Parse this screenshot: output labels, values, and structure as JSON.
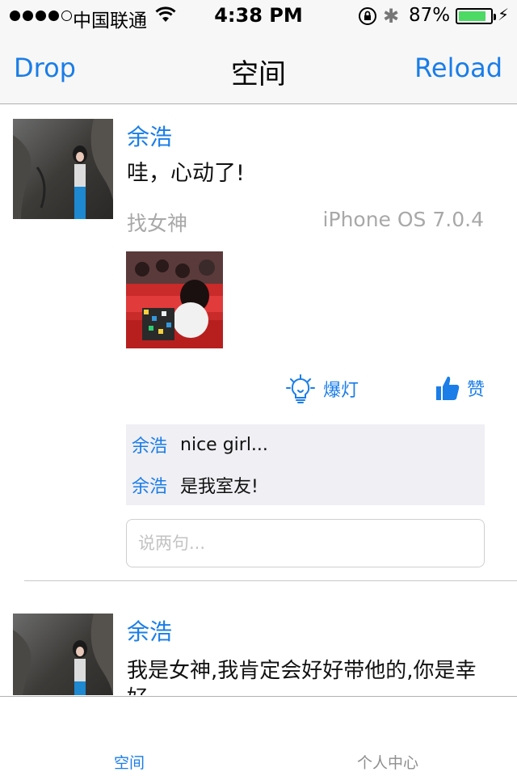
{
  "status_bar": {
    "carrier": "中国联通",
    "time": "4:38 PM",
    "battery_percent": "87%",
    "battery_level": 0.87,
    "signal_bars_filled": 4,
    "signal_bars_total": 5,
    "battery_color": "#4cd964"
  },
  "nav": {
    "left_label": "Drop",
    "title": "空间",
    "right_label": "Reload",
    "accent_color": "#1a7de8"
  },
  "posts": [
    {
      "author": "余浩",
      "text": "哇，心动了!",
      "group": "找女神",
      "device": "iPhone OS 7.0.4",
      "actions": {
        "flash_label": "爆灯",
        "like_label": "赞"
      },
      "comments": [
        {
          "author": "余浩",
          "text": "nice girl..."
        },
        {
          "author": "余浩",
          "text": "是我室友!"
        }
      ],
      "reply_placeholder": "说两句..."
    },
    {
      "author": "余浩",
      "text": "我是女神,我肯定会好好带他的,你是幸好"
    }
  ],
  "tab_bar": {
    "tabs": [
      {
        "label": "空间",
        "active": true
      },
      {
        "label": "个人中心",
        "active": false
      }
    ]
  }
}
